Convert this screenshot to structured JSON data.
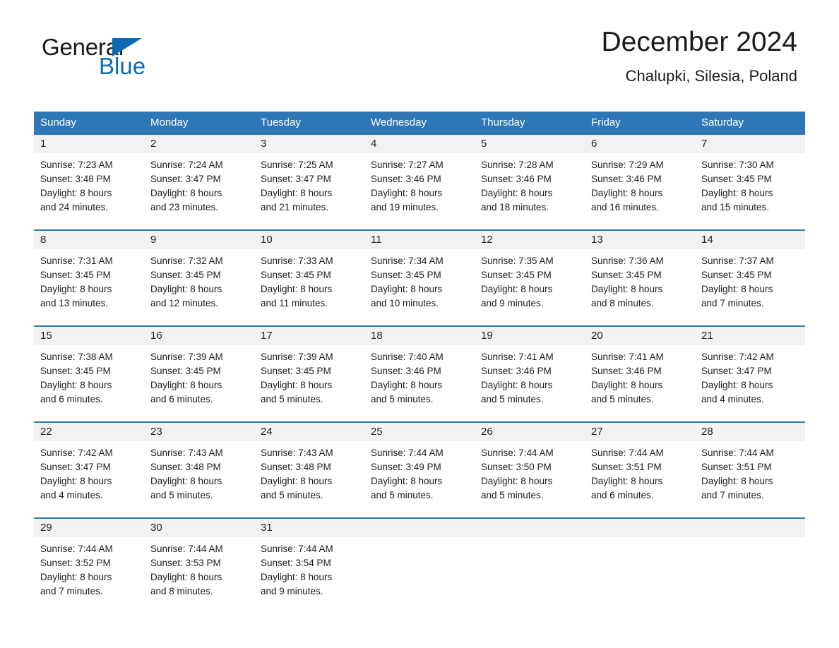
{
  "brand": {
    "name_part1": "General",
    "name_part2": "Blue",
    "accent_color": "#0d6ab0"
  },
  "header": {
    "title": "December 2024",
    "location": "Chalupki, Silesia, Poland"
  },
  "calendar": {
    "header_bg": "#2e77b6",
    "daynum_bg": "#f2f2f2",
    "weekdays": [
      "Sunday",
      "Monday",
      "Tuesday",
      "Wednesday",
      "Thursday",
      "Friday",
      "Saturday"
    ],
    "weeks": [
      [
        {
          "day": "1",
          "sunrise": "Sunrise: 7:23 AM",
          "sunset": "Sunset: 3:48 PM",
          "daylight_line1": "Daylight: 8 hours",
          "daylight_line2": "and 24 minutes."
        },
        {
          "day": "2",
          "sunrise": "Sunrise: 7:24 AM",
          "sunset": "Sunset: 3:47 PM",
          "daylight_line1": "Daylight: 8 hours",
          "daylight_line2": "and 23 minutes."
        },
        {
          "day": "3",
          "sunrise": "Sunrise: 7:25 AM",
          "sunset": "Sunset: 3:47 PM",
          "daylight_line1": "Daylight: 8 hours",
          "daylight_line2": "and 21 minutes."
        },
        {
          "day": "4",
          "sunrise": "Sunrise: 7:27 AM",
          "sunset": "Sunset: 3:46 PM",
          "daylight_line1": "Daylight: 8 hours",
          "daylight_line2": "and 19 minutes."
        },
        {
          "day": "5",
          "sunrise": "Sunrise: 7:28 AM",
          "sunset": "Sunset: 3:46 PM",
          "daylight_line1": "Daylight: 8 hours",
          "daylight_line2": "and 18 minutes."
        },
        {
          "day": "6",
          "sunrise": "Sunrise: 7:29 AM",
          "sunset": "Sunset: 3:46 PM",
          "daylight_line1": "Daylight: 8 hours",
          "daylight_line2": "and 16 minutes."
        },
        {
          "day": "7",
          "sunrise": "Sunrise: 7:30 AM",
          "sunset": "Sunset: 3:45 PM",
          "daylight_line1": "Daylight: 8 hours",
          "daylight_line2": "and 15 minutes."
        }
      ],
      [
        {
          "day": "8",
          "sunrise": "Sunrise: 7:31 AM",
          "sunset": "Sunset: 3:45 PM",
          "daylight_line1": "Daylight: 8 hours",
          "daylight_line2": "and 13 minutes."
        },
        {
          "day": "9",
          "sunrise": "Sunrise: 7:32 AM",
          "sunset": "Sunset: 3:45 PM",
          "daylight_line1": "Daylight: 8 hours",
          "daylight_line2": "and 12 minutes."
        },
        {
          "day": "10",
          "sunrise": "Sunrise: 7:33 AM",
          "sunset": "Sunset: 3:45 PM",
          "daylight_line1": "Daylight: 8 hours",
          "daylight_line2": "and 11 minutes."
        },
        {
          "day": "11",
          "sunrise": "Sunrise: 7:34 AM",
          "sunset": "Sunset: 3:45 PM",
          "daylight_line1": "Daylight: 8 hours",
          "daylight_line2": "and 10 minutes."
        },
        {
          "day": "12",
          "sunrise": "Sunrise: 7:35 AM",
          "sunset": "Sunset: 3:45 PM",
          "daylight_line1": "Daylight: 8 hours",
          "daylight_line2": "and 9 minutes."
        },
        {
          "day": "13",
          "sunrise": "Sunrise: 7:36 AM",
          "sunset": "Sunset: 3:45 PM",
          "daylight_line1": "Daylight: 8 hours",
          "daylight_line2": "and 8 minutes."
        },
        {
          "day": "14",
          "sunrise": "Sunrise: 7:37 AM",
          "sunset": "Sunset: 3:45 PM",
          "daylight_line1": "Daylight: 8 hours",
          "daylight_line2": "and 7 minutes."
        }
      ],
      [
        {
          "day": "15",
          "sunrise": "Sunrise: 7:38 AM",
          "sunset": "Sunset: 3:45 PM",
          "daylight_line1": "Daylight: 8 hours",
          "daylight_line2": "and 6 minutes."
        },
        {
          "day": "16",
          "sunrise": "Sunrise: 7:39 AM",
          "sunset": "Sunset: 3:45 PM",
          "daylight_line1": "Daylight: 8 hours",
          "daylight_line2": "and 6 minutes."
        },
        {
          "day": "17",
          "sunrise": "Sunrise: 7:39 AM",
          "sunset": "Sunset: 3:45 PM",
          "daylight_line1": "Daylight: 8 hours",
          "daylight_line2": "and 5 minutes."
        },
        {
          "day": "18",
          "sunrise": "Sunrise: 7:40 AM",
          "sunset": "Sunset: 3:46 PM",
          "daylight_line1": "Daylight: 8 hours",
          "daylight_line2": "and 5 minutes."
        },
        {
          "day": "19",
          "sunrise": "Sunrise: 7:41 AM",
          "sunset": "Sunset: 3:46 PM",
          "daylight_line1": "Daylight: 8 hours",
          "daylight_line2": "and 5 minutes."
        },
        {
          "day": "20",
          "sunrise": "Sunrise: 7:41 AM",
          "sunset": "Sunset: 3:46 PM",
          "daylight_line1": "Daylight: 8 hours",
          "daylight_line2": "and 5 minutes."
        },
        {
          "day": "21",
          "sunrise": "Sunrise: 7:42 AM",
          "sunset": "Sunset: 3:47 PM",
          "daylight_line1": "Daylight: 8 hours",
          "daylight_line2": "and 4 minutes."
        }
      ],
      [
        {
          "day": "22",
          "sunrise": "Sunrise: 7:42 AM",
          "sunset": "Sunset: 3:47 PM",
          "daylight_line1": "Daylight: 8 hours",
          "daylight_line2": "and 4 minutes."
        },
        {
          "day": "23",
          "sunrise": "Sunrise: 7:43 AM",
          "sunset": "Sunset: 3:48 PM",
          "daylight_line1": "Daylight: 8 hours",
          "daylight_line2": "and 5 minutes."
        },
        {
          "day": "24",
          "sunrise": "Sunrise: 7:43 AM",
          "sunset": "Sunset: 3:48 PM",
          "daylight_line1": "Daylight: 8 hours",
          "daylight_line2": "and 5 minutes."
        },
        {
          "day": "25",
          "sunrise": "Sunrise: 7:44 AM",
          "sunset": "Sunset: 3:49 PM",
          "daylight_line1": "Daylight: 8 hours",
          "daylight_line2": "and 5 minutes."
        },
        {
          "day": "26",
          "sunrise": "Sunrise: 7:44 AM",
          "sunset": "Sunset: 3:50 PM",
          "daylight_line1": "Daylight: 8 hours",
          "daylight_line2": "and 5 minutes."
        },
        {
          "day": "27",
          "sunrise": "Sunrise: 7:44 AM",
          "sunset": "Sunset: 3:51 PM",
          "daylight_line1": "Daylight: 8 hours",
          "daylight_line2": "and 6 minutes."
        },
        {
          "day": "28",
          "sunrise": "Sunrise: 7:44 AM",
          "sunset": "Sunset: 3:51 PM",
          "daylight_line1": "Daylight: 8 hours",
          "daylight_line2": "and 7 minutes."
        }
      ],
      [
        {
          "day": "29",
          "sunrise": "Sunrise: 7:44 AM",
          "sunset": "Sunset: 3:52 PM",
          "daylight_line1": "Daylight: 8 hours",
          "daylight_line2": "and 7 minutes."
        },
        {
          "day": "30",
          "sunrise": "Sunrise: 7:44 AM",
          "sunset": "Sunset: 3:53 PM",
          "daylight_line1": "Daylight: 8 hours",
          "daylight_line2": "and 8 minutes."
        },
        {
          "day": "31",
          "sunrise": "Sunrise: 7:44 AM",
          "sunset": "Sunset: 3:54 PM",
          "daylight_line1": "Daylight: 8 hours",
          "daylight_line2": "and 9 minutes."
        },
        {
          "day": "",
          "sunrise": "",
          "sunset": "",
          "daylight_line1": "",
          "daylight_line2": ""
        },
        {
          "day": "",
          "sunrise": "",
          "sunset": "",
          "daylight_line1": "",
          "daylight_line2": ""
        },
        {
          "day": "",
          "sunrise": "",
          "sunset": "",
          "daylight_line1": "",
          "daylight_line2": ""
        },
        {
          "day": "",
          "sunrise": "",
          "sunset": "",
          "daylight_line1": "",
          "daylight_line2": ""
        }
      ]
    ]
  }
}
